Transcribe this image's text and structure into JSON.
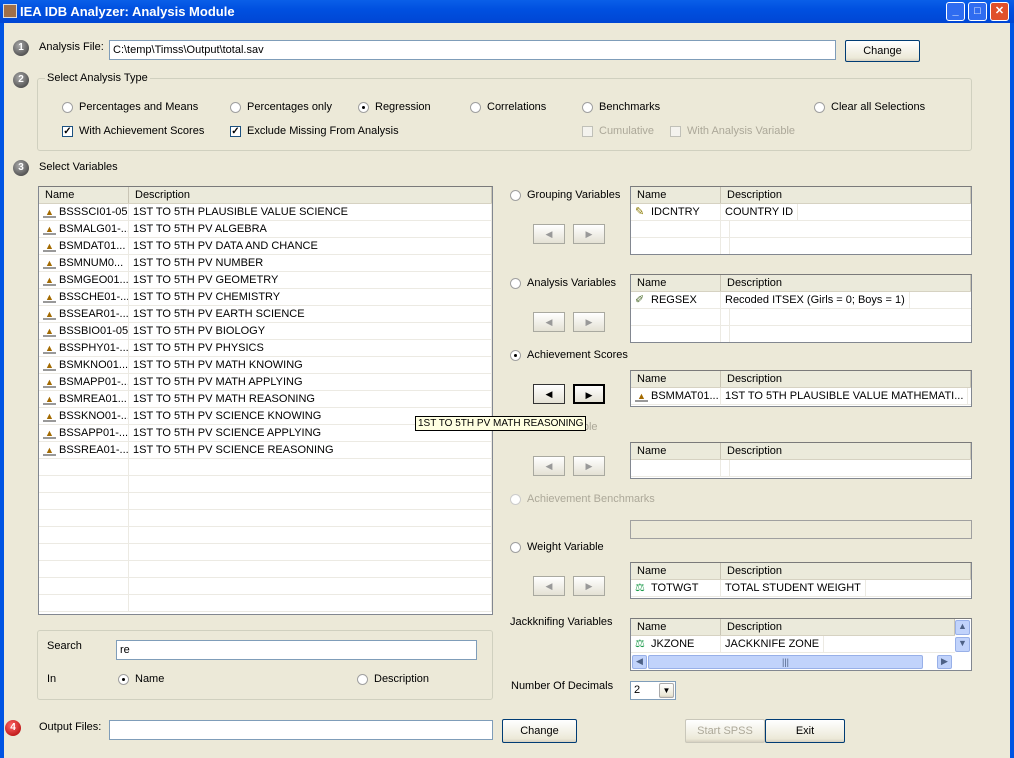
{
  "window": {
    "title": "IEA IDB Analyzer: Analysis Module",
    "minimize": "_",
    "maximize": "□",
    "close": "✕"
  },
  "step1": {
    "num": "1",
    "label": "Analysis File:",
    "value": "C:\\temp\\Timss\\Output\\total.sav",
    "change": "Change"
  },
  "step2": {
    "num": "2",
    "legend": "Select Analysis Type",
    "radios": [
      {
        "label": "Percentages and Means",
        "checked": false
      },
      {
        "label": "Percentages only",
        "checked": false
      },
      {
        "label": "Regression",
        "checked": true
      },
      {
        "label": "Correlations",
        "checked": false
      },
      {
        "label": "Benchmarks",
        "checked": false
      },
      {
        "label": "Clear all Selections",
        "checked": false
      }
    ],
    "checks": [
      {
        "label": "With Achievement Scores",
        "checked": true
      },
      {
        "label": "Exclude Missing From Analysis",
        "checked": true
      },
      {
        "label": "Cumulative",
        "checked": false,
        "disabled": true
      },
      {
        "label": "With Analysis Variable",
        "checked": false,
        "disabled": true
      }
    ]
  },
  "step3": {
    "num": "3",
    "label": "Select Variables"
  },
  "varlist": {
    "col_name": "Name",
    "col_desc": "Description",
    "rows": [
      {
        "name": "BSSSCI01-05",
        "desc": "1ST TO 5TH PLAUSIBLE VALUE SCIENCE"
      },
      {
        "name": "BSMALG01-...",
        "desc": "1ST TO 5TH PV ALGEBRA"
      },
      {
        "name": "BSMDAT01...",
        "desc": "1ST TO 5TH PV DATA AND CHANCE"
      },
      {
        "name": "BSMNUM0...",
        "desc": "1ST TO 5TH PV NUMBER"
      },
      {
        "name": "BSMGEO01...",
        "desc": "1ST TO 5TH PV GEOMETRY"
      },
      {
        "name": "BSSCHE01-...",
        "desc": "1ST TO 5TH PV CHEMISTRY"
      },
      {
        "name": "BSSEAR01-...",
        "desc": "1ST TO 5TH PV EARTH SCIENCE"
      },
      {
        "name": "BSSBIO01-05",
        "desc": "1ST TO 5TH PV BIOLOGY"
      },
      {
        "name": "BSSPHY01-...",
        "desc": "1ST TO 5TH PV PHYSICS"
      },
      {
        "name": "BSMKNO01...",
        "desc": "1ST TO 5TH PV MATH KNOWING"
      },
      {
        "name": "BSMAPP01-...",
        "desc": "1ST TO 5TH PV MATH APPLYING"
      },
      {
        "name": "BSMREA01...",
        "desc": "1ST TO 5TH PV MATH REASONING"
      },
      {
        "name": "BSSKNO01-...",
        "desc": "1ST TO 5TH PV SCIENCE KNOWING"
      },
      {
        "name": "BSSAPP01-...",
        "desc": "1ST TO 5TH PV SCIENCE APPLYING"
      },
      {
        "name": "BSSREA01-...",
        "desc": "1ST TO 5TH PV SCIENCE REASONING"
      }
    ]
  },
  "search": {
    "label": "Search",
    "value": "re",
    "in_label": "In",
    "opt_name": "Name",
    "opt_desc": "Description"
  },
  "tooltip": "1ST TO 5TH PV MATH REASONING",
  "right": {
    "col_name": "Name",
    "col_desc": "Description",
    "grouping": {
      "label": "Grouping Variables",
      "rows": [
        {
          "name": "IDCNTRY",
          "desc": "COUNTRY ID"
        }
      ]
    },
    "analysis": {
      "label": "Analysis Variables",
      "rows": [
        {
          "name": "REGSEX",
          "desc": "Recoded ITSEX (Girls = 0; Boys = 1)"
        }
      ]
    },
    "achievement": {
      "label": "Achievement Scores",
      "rows": [
        {
          "name": "BSMMAT01...",
          "desc": "1ST TO 5TH PLAUSIBLE VALUE MATHEMATI..."
        }
      ]
    },
    "hidden_label": "Variable",
    "benchmarks": {
      "label": "Achievement Benchmarks"
    },
    "weight": {
      "label": "Weight Variable",
      "rows": [
        {
          "name": "TOTWGT",
          "desc": "TOTAL STUDENT WEIGHT"
        }
      ]
    },
    "jackknife": {
      "label": "Jackknifing Variables",
      "rows": [
        {
          "name": "JKZONE",
          "desc": "JACKKNIFE ZONE"
        }
      ]
    },
    "decimals": {
      "label": "Number Of Decimals",
      "value": "2"
    }
  },
  "step4": {
    "num": "4",
    "label": "Output Files:",
    "value": "",
    "change": "Change",
    "start": "Start SPSS",
    "exit": "Exit"
  }
}
